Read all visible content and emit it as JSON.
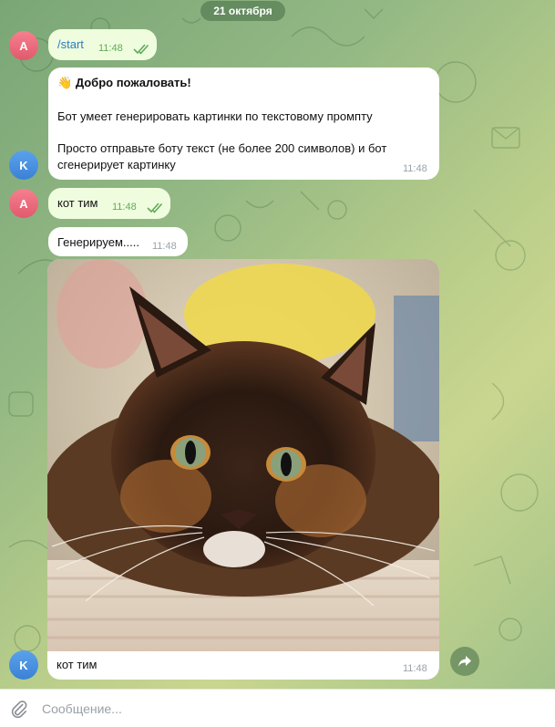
{
  "chat": {
    "date_label": "21 октября",
    "user_initial": "A",
    "bot_initial": "K"
  },
  "messages": {
    "start": {
      "text": "/start",
      "time": "11:48"
    },
    "welcome": {
      "emoji": "👋",
      "title": "Добро пожаловать!",
      "line1": "Бот умеет генерировать картинки по текстовому промпту",
      "line2": "Просто отправьте боту текст (не более 200 символов) и бот",
      "line3": "сгенерирует картинку",
      "time": "11:48"
    },
    "user_prompt": {
      "text": "кот тим",
      "time": "11:48"
    },
    "generating": {
      "text": "Генерируем.....",
      "time": "11:48"
    },
    "image_result": {
      "caption": "кот тим",
      "time": "11:48"
    }
  },
  "composer": {
    "placeholder": "Сообщение..."
  },
  "icons": {
    "read_checks": "double-check-icon",
    "share": "share-arrow-icon",
    "attach": "paperclip-icon"
  },
  "colors": {
    "outgoing_bubble": "#effdde",
    "incoming_bubble": "#ffffff",
    "avatar_user": "#e96577",
    "avatar_bot": "#4a92e2",
    "link": "#2a7cc3"
  }
}
